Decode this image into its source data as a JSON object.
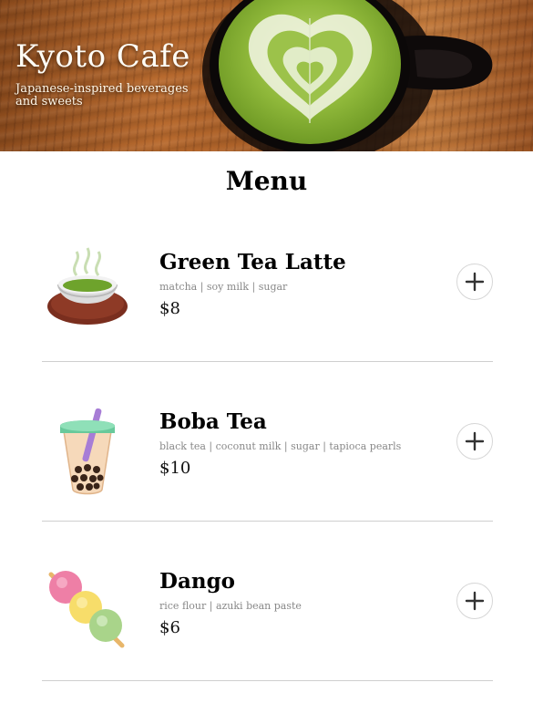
{
  "hero": {
    "title": "Kyoto Cafe",
    "subtitle": "Japanese-inspired beverages and sweets"
  },
  "menu": {
    "title": "Menu",
    "items": [
      {
        "name": "Green Tea Latte",
        "ingredients": "matcha | soy milk | sugar",
        "price": "$8",
        "icon": "green-tea-icon"
      },
      {
        "name": "Boba Tea",
        "ingredients": "black tea | coconut milk | sugar | tapioca pearls",
        "price": "$10",
        "icon": "bubble-tea-icon"
      },
      {
        "name": "Dango",
        "ingredients": "rice flour | azuki bean paste",
        "price": "$6",
        "icon": "dango-icon"
      }
    ]
  },
  "icons": {
    "add": "plus-icon"
  },
  "colors": {
    "divider": "#cfcfcf",
    "ingredients": "#888888",
    "matcha": "#7fae3a"
  }
}
